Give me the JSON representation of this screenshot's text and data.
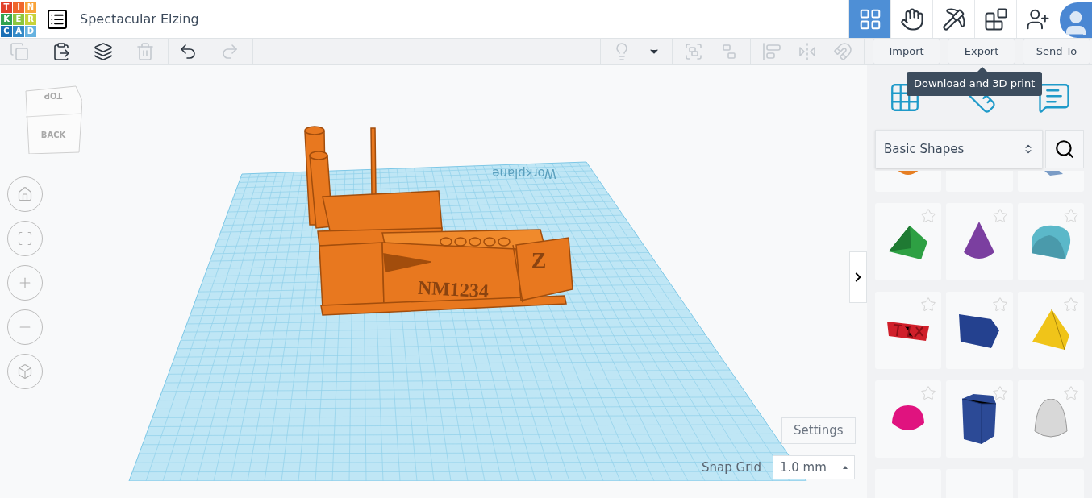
{
  "logo": {
    "letters": [
      {
        "char": "T",
        "color": "#e2412b"
      },
      {
        "char": "I",
        "color": "#f0662c"
      },
      {
        "char": "N",
        "color": "#f9a33a"
      },
      {
        "char": "K",
        "color": "#31a24f"
      },
      {
        "char": "E",
        "color": "#8cc63f"
      },
      {
        "char": "R",
        "color": "#c7d23a"
      },
      {
        "char": "C",
        "color": "#1a6fb5"
      },
      {
        "char": "A",
        "color": "#3389c7"
      },
      {
        "char": "D",
        "color": "#66b2e0"
      }
    ]
  },
  "title": "Spectacular Elzing",
  "nav": [
    {
      "kind": "grid",
      "selected": true
    },
    {
      "kind": "hand",
      "selected": false
    },
    {
      "kind": "pickaxe",
      "selected": false
    },
    {
      "kind": "bricks",
      "selected": false
    },
    {
      "kind": "add-user",
      "selected": false
    }
  ],
  "toolbar": {
    "groups": [
      [
        {
          "kind": "copy",
          "disabled": true
        },
        {
          "kind": "paste",
          "disabled": false
        },
        {
          "kind": "duplicate",
          "disabled": false
        },
        {
          "kind": "delete",
          "disabled": true
        }
      ],
      [
        {
          "kind": "undo",
          "disabled": false
        },
        {
          "kind": "redo",
          "disabled": true
        }
      ]
    ],
    "right_groups": [
      [
        {
          "kind": "light",
          "disabled": true
        },
        {
          "kind": "caret",
          "disabled": false
        }
      ],
      [
        {
          "kind": "group",
          "disabled": true
        },
        {
          "kind": "ungroup",
          "disabled": true
        }
      ],
      [
        {
          "kind": "align",
          "disabled": true
        },
        {
          "kind": "mirror",
          "disabled": true
        },
        {
          "kind": "magnet",
          "disabled": true
        }
      ]
    ],
    "buttons": [
      "Import",
      "Export",
      "Send To"
    ]
  },
  "tooltip": "Download and 3D print",
  "view_cube": {
    "top": "TOP",
    "front": "BACK"
  },
  "view_controls": [
    {
      "kind": "home"
    },
    {
      "kind": "fit"
    },
    {
      "kind": "zoom-in"
    },
    {
      "kind": "zoom-out"
    },
    {
      "kind": "view"
    }
  ],
  "scene": {
    "workplane_label": "Workplane",
    "model_text": "NM1234",
    "model_letter": "Z"
  },
  "panel": {
    "views": [
      {
        "kind": "grid"
      },
      {
        "kind": "ruler"
      },
      {
        "kind": "notes"
      }
    ],
    "library": "Basic Shapes",
    "shapes": [
      {
        "kind": "sphere",
        "color": "#e67e22"
      },
      {
        "kind": "none"
      },
      {
        "kind": "wedge-partial",
        "color": "#7a9cc6"
      },
      {
        "kind": "roof",
        "color": "#2ea043"
      },
      {
        "kind": "cone",
        "color": "#7b3fa0"
      },
      {
        "kind": "half-cylinder",
        "color": "#5bb8c9"
      },
      {
        "kind": "text",
        "color": "#d01f2a"
      },
      {
        "kind": "polygon",
        "color": "#24418f"
      },
      {
        "kind": "pyramid",
        "color": "#f0c419"
      },
      {
        "kind": "hemisphere",
        "color": "#e0137f"
      },
      {
        "kind": "prism",
        "color": "#2c4a96"
      },
      {
        "kind": "paraboloid",
        "color": "#d8d8d8"
      }
    ]
  },
  "settings": "Settings",
  "snap_grid": {
    "label": "Snap Grid",
    "value": "1.0 mm"
  }
}
